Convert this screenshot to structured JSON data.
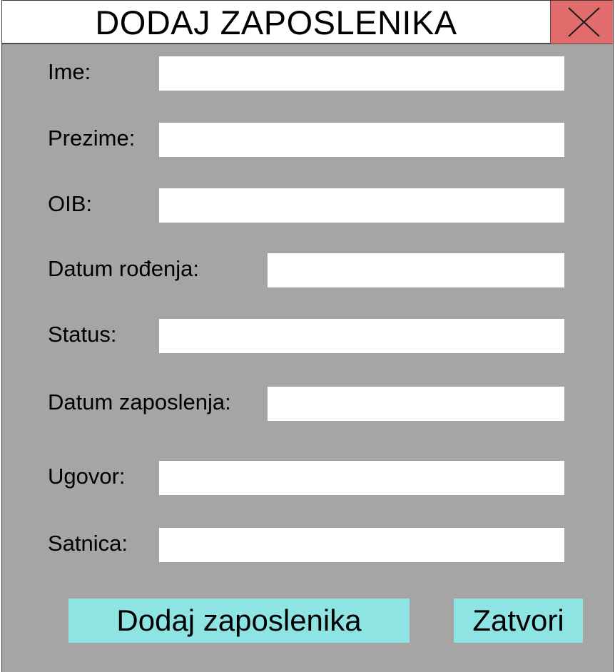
{
  "window": {
    "title": "DODAJ ZAPOSLENIKA"
  },
  "form": {
    "fields": [
      {
        "label": "Ime:",
        "value": "",
        "placeholder": ""
      },
      {
        "label": "Prezime:",
        "value": "",
        "placeholder": ""
      },
      {
        "label": "OIB:",
        "value": "",
        "placeholder": ""
      },
      {
        "label": "Datum rođenja:",
        "value": "",
        "placeholder": ""
      },
      {
        "label": "Status:",
        "value": "",
        "placeholder": ""
      },
      {
        "label": "Datum zaposlenja:",
        "value": "",
        "placeholder": ""
      },
      {
        "label": "Ugovor:",
        "value": "",
        "placeholder": ""
      },
      {
        "label": "Satnica:",
        "value": "",
        "placeholder": ""
      }
    ]
  },
  "actions": {
    "add_label": "Dodaj zaposlenika",
    "close_label": "Zatvori"
  },
  "icons": {
    "close": "close-icon"
  },
  "colors": {
    "background": "#a5a5a5",
    "close_button": "#e26b6b",
    "action_buttons": "#8ee3e3",
    "field": "#ffffff"
  }
}
